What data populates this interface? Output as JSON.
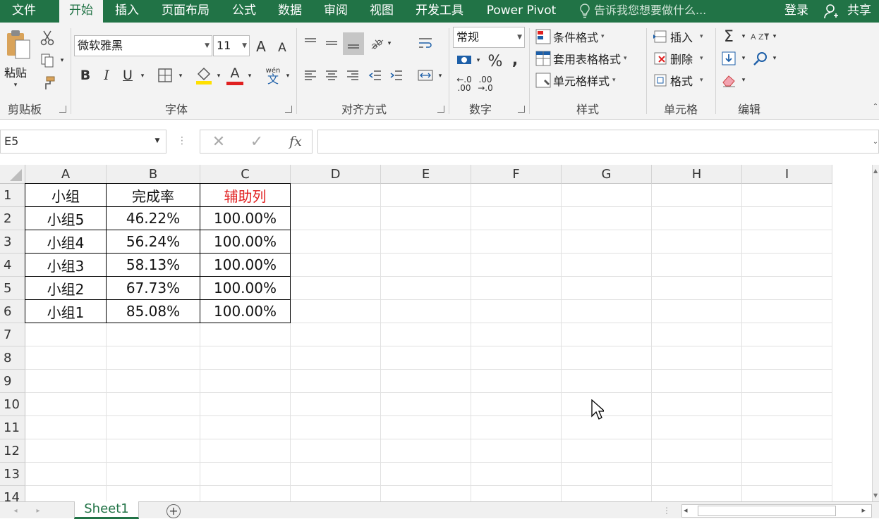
{
  "tabs": {
    "file": "文件",
    "home": "开始",
    "insert": "插入",
    "page_layout": "页面布局",
    "formulas": "公式",
    "data": "数据",
    "review": "审阅",
    "view": "视图",
    "developer": "开发工具",
    "power_pivot": "Power Pivot",
    "tell_me": "告诉我您想要做什么...",
    "login": "登录",
    "share": "共享"
  },
  "ribbon": {
    "clipboard": {
      "paste": "粘贴",
      "label": "剪贴板"
    },
    "font": {
      "name": "微软雅黑",
      "size": "11",
      "label": "字体",
      "bold": "B",
      "italic": "I",
      "underline": "U",
      "phonetic_top": "wén",
      "phonetic_bottom": "文",
      "grow": "A",
      "shrink": "A",
      "font_color_letter": "A"
    },
    "alignment": {
      "label": "对齐方式"
    },
    "number": {
      "format": "常规",
      "label": "数字",
      "percent": "%",
      "comma": ",",
      "inc_decimal_top": "←.0",
      "inc_decimal_bottom": ".00",
      "dec_decimal_top": ".00",
      "dec_decimal_bottom": "→.0"
    },
    "styles": {
      "conditional": "条件格式",
      "table": "套用表格格式",
      "cell_styles": "单元格样式",
      "label": "样式"
    },
    "cells": {
      "insert": "插入",
      "delete": "删除",
      "format": "格式",
      "label": "单元格"
    },
    "editing": {
      "label": "编辑",
      "sum": "Σ",
      "sort": "A Z"
    }
  },
  "formula_bar": {
    "name_box": "E5",
    "fx": "fx",
    "formula": ""
  },
  "columns": [
    "A",
    "B",
    "C",
    "D",
    "E",
    "F",
    "G",
    "H",
    "I"
  ],
  "rows": [
    "1",
    "2",
    "3",
    "4",
    "5",
    "6",
    "7",
    "8",
    "9",
    "10",
    "11",
    "12",
    "13",
    "14"
  ],
  "table": {
    "headers": [
      "小组",
      "完成率",
      "辅助列"
    ],
    "helper_header_color": "#e02020",
    "data": [
      [
        "小组5",
        "46.22%",
        "100.00%"
      ],
      [
        "小组4",
        "56.24%",
        "100.00%"
      ],
      [
        "小组3",
        "58.13%",
        "100.00%"
      ],
      [
        "小组2",
        "67.73%",
        "100.00%"
      ],
      [
        "小组1",
        "85.08%",
        "100.00%"
      ]
    ]
  },
  "sheets": {
    "active": "Sheet1",
    "add": "+"
  },
  "colors": {
    "accent": "#217346"
  }
}
